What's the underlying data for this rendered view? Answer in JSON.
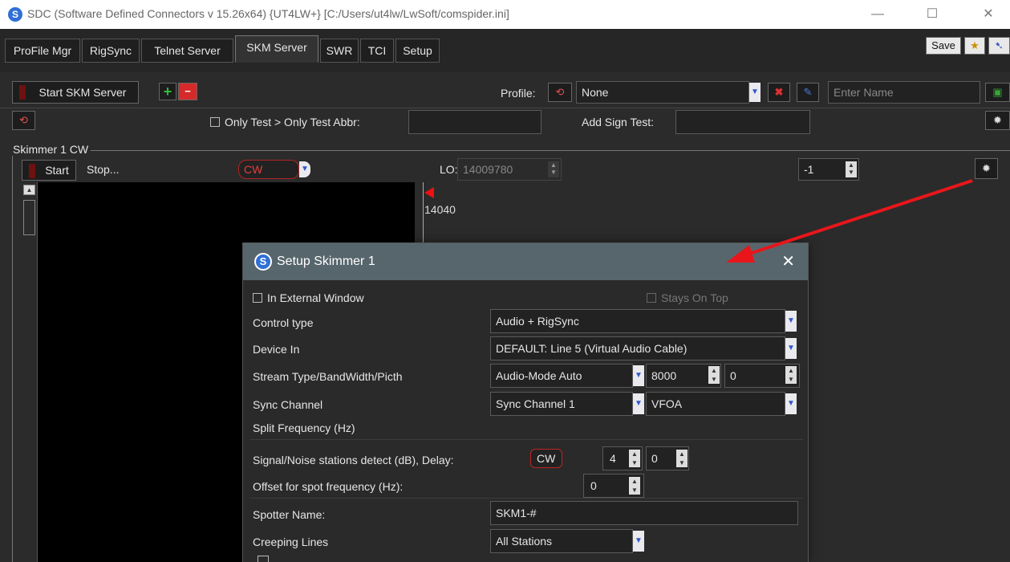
{
  "window": {
    "title": "SDC (Software Defined Connectors v 15.26x64) {UT4LW+} [C:/Users/ut4lw/LwSoft/comspider.ini]",
    "icon": "sdc-logo-icon",
    "controls": {
      "minimize": "—",
      "maximize": "☐",
      "close": "✕"
    }
  },
  "tabs": [
    {
      "label": "ProFile Mgr"
    },
    {
      "label": "RigSync"
    },
    {
      "label": "Telnet Server"
    },
    {
      "label": "SKM Server",
      "active": true
    },
    {
      "label": "SWR"
    },
    {
      "label": "TCI"
    },
    {
      "label": "Setup"
    }
  ],
  "topright": {
    "save_label": "Save",
    "star": "★"
  },
  "toolbar": {
    "start_label": "Start SKM Server",
    "add": "+",
    "remove": "−",
    "profile_label": "Profile:",
    "profile_value": "None",
    "name_placeholder": "Enter Name"
  },
  "filterbar": {
    "only_test_label": "Only Test  > Only Test Abbr:",
    "add_sign_label": "Add Sign Test:"
  },
  "skimmer": {
    "group_title": "Skimmer 1 CW",
    "start_label": "Start",
    "stop_label": "Stop...",
    "mode": "CW",
    "lo_label": "LO:",
    "lo_value": "14009780",
    "offset_value": "-1",
    "scale_label": "14040"
  },
  "dialog": {
    "title": "Setup Skimmer 1",
    "close": "✕",
    "in_external_window": "In External Window",
    "stays_on_top": "Stays On Top",
    "control_type_label": "Control type",
    "control_type_value": "Audio + RigSync",
    "device_in_label": "Device In",
    "device_in_value": "DEFAULT: Line 5 (Virtual Audio Cable)",
    "stream_label": "Stream Type/BandWidth/Picth",
    "stream_type_value": "Audio-Mode Auto",
    "bandwidth_value": "8000",
    "pitch_value": "0",
    "sync_channel_label": "Sync Channel",
    "sync_channel_value": "Sync Channel 1",
    "vfo_value": "VFOA",
    "split_label": "Split Frequency (Hz)",
    "snr_label": "Signal/Noise stations detect (dB), Delay:",
    "snr_mode": "CW",
    "snr_value": "4",
    "delay_value": "0",
    "offset_label": "Offset for spot frequency (Hz):",
    "offset_value": "0",
    "spotter_label": "Spotter Name:",
    "spotter_value": "SKM1-#",
    "creeping_label": "Creeping Lines",
    "creeping_value": "All Stations"
  },
  "colors": {
    "annotation_arrow": "#e8161b",
    "dialog_header": "#57666d",
    "accent_blue": "#2f6fd6"
  }
}
